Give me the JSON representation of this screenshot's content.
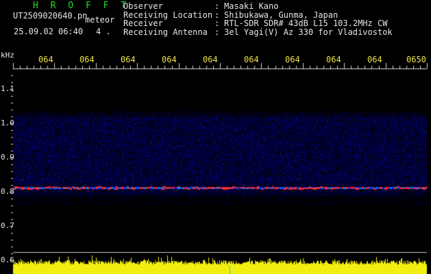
{
  "header": {
    "title": "H R O F F T",
    "filename": "UT2509020640.pn",
    "meteor_label": "meteor",
    "datetime": "25.09.02 06:40",
    "count": "4 ."
  },
  "info": [
    {
      "key": "Observer",
      "sep": ":",
      "value": "Masaki Kano"
    },
    {
      "key": "Receiving Location",
      "sep": ":",
      "value": "Shibukawa, Gunma, Japan"
    },
    {
      "key": "Receiver",
      "sep": ":",
      "value": "RTL-SDR SDR# 43dB L15 103.2MHz CW"
    },
    {
      "key": "Receiving Antenna",
      "sep": ":",
      "value": "3el Yagi(V) Az 330 for Vladivostok"
    }
  ],
  "axis": {
    "y_unit": "kHz",
    "y_labels": [
      "1.1",
      "1.0",
      "0.9",
      "0.8",
      "0.7",
      "0.6"
    ],
    "x_labels": [
      "064",
      "064",
      "064",
      "064",
      "064",
      "064",
      "064",
      "064",
      "064",
      "0650"
    ]
  },
  "colors": {
    "background": "#000000",
    "text": "#e6e6e6",
    "title": "#22e022",
    "time_labels": "#f0e24a",
    "noise_bar": "#f2ee10",
    "signal": "#ff2a2a"
  }
}
